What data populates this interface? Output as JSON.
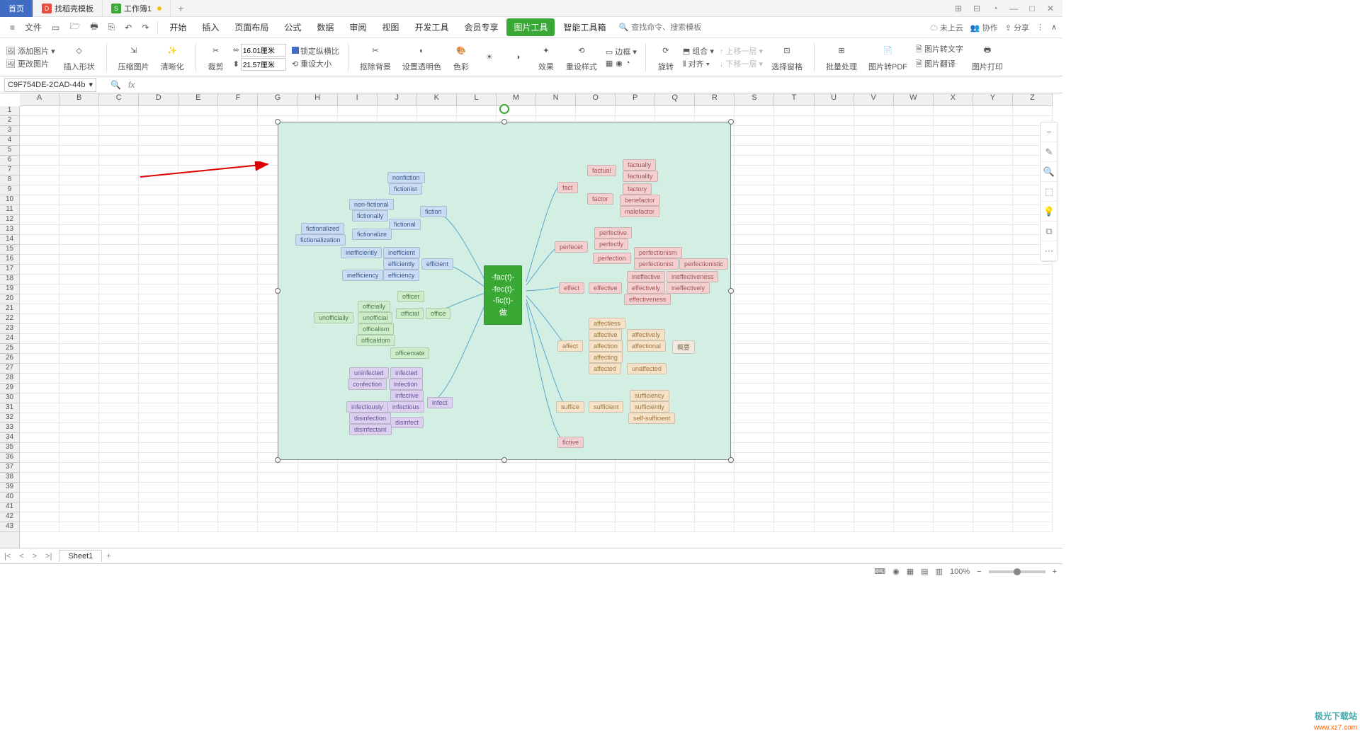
{
  "titlebar": {
    "tabs": [
      {
        "label": "首页"
      },
      {
        "label": "找稻壳模板",
        "icon": "D"
      },
      {
        "label": "工作簿1",
        "icon": "S",
        "modified": true
      }
    ]
  },
  "menubar": {
    "file": "文件",
    "items": [
      "开始",
      "插入",
      "页面布局",
      "公式",
      "数据",
      "审阅",
      "视图",
      "开发工具",
      "会员专享",
      "图片工具",
      "智能工具箱"
    ],
    "active_index": 9,
    "search_placeholder": "查找命令、搜索模板",
    "right": {
      "cloud": "未上云",
      "collab": "协作",
      "share": "分享"
    }
  },
  "ribbon": {
    "add_image": "添加图片",
    "change_image": "更改图片",
    "insert_shape": "插入形状",
    "compress": "压缩图片",
    "enhance": "清晰化",
    "crop": "裁剪",
    "width_value": "16.01厘米",
    "height_value": "21.57厘米",
    "lock_ratio": "锁定纵横比",
    "reset_size": "重设大小",
    "remove_bg": "抠除背景",
    "transparency": "设置透明色",
    "color": "色彩",
    "effect": "效果",
    "reset_style": "重设样式",
    "border": "边框",
    "rotate": "旋转",
    "combine": "组合",
    "align": "对齐",
    "layer_up": "上移一层",
    "layer_down": "下移一层",
    "select_pane": "选择窗格",
    "batch": "批量处理",
    "to_pdf": "图片转PDF",
    "to_text": "图片转文字",
    "translate": "图片翻译",
    "print": "图片打印"
  },
  "formula_bar": {
    "name": "C9F754DE-2CAD-44b",
    "fx": "fx"
  },
  "columns": [
    "A",
    "B",
    "C",
    "D",
    "E",
    "F",
    "G",
    "H",
    "I",
    "J",
    "K",
    "L",
    "M",
    "N",
    "O",
    "P",
    "Q",
    "R",
    "S",
    "T",
    "U",
    "V",
    "W",
    "X",
    "Y",
    "Z"
  ],
  "row_count": 43,
  "mindmap": {
    "center": "-fac(t)-\n-fec(t)-\n-fic(t)-\n做",
    "nodes": {
      "fiction": "fiction",
      "nonfiction": "nonfiction",
      "fictionist": "fictionist",
      "nonfictional": "non-fictional",
      "fictionally": "fictionally",
      "fictional": "fictional",
      "fictionalize": "fictionalize",
      "fictionalized": "fictionalized",
      "fictionalization": "fictionalization",
      "efficient": "efficient",
      "inefficient": "inefficient",
      "inefficiently": "inefficiently",
      "efficiently": "efficiently",
      "efficiency": "efficiency",
      "inefficiency": "inefficiency",
      "office": "office",
      "officer": "officer",
      "official": "official",
      "unofficial": "unofficial",
      "officially": "officially",
      "officialism": "officalism",
      "officialdom": "officaldom",
      "officemate": "officemate",
      "unofficially": "unofficially",
      "infect": "infect",
      "infected": "infected",
      "uninfected": "uninfected",
      "infection": "infection",
      "confection": "confection",
      "infective": "infective",
      "infectious": "infectious",
      "infectiously": "infectiously",
      "disinfect": "disinfect",
      "disinfection": "disinfection",
      "disinfectant": "disinfectant",
      "fact": "fact",
      "factual": "factual",
      "factually": "factually",
      "factuality": "factuality",
      "factor": "factor",
      "factory": "factory",
      "benefactor": "benefactor",
      "malefactor": "malefactor",
      "perfect_branch": "perfecet",
      "perfective": "perfective",
      "perfectly": "perfectly",
      "perfection": "perfection",
      "perfectionism": "perfectionism",
      "perfectionist": "perfectionist",
      "perfectionistic": "perfectionistic",
      "effect": "effect",
      "effective": "effective",
      "ineffective": "ineffective",
      "ineffectiveness": "ineffectiveness",
      "effectively": "effectively",
      "ineffectively": "ineffectively",
      "effectiveness": "effectiveness",
      "affect": "affect",
      "affectless": "affectless",
      "affective": "affective",
      "affectively": "affectively",
      "affection": "affection",
      "affectional": "affectional",
      "affecting": "affecting",
      "affected": "affected",
      "unaffected": "unaffected",
      "summary": "概要",
      "suffice": "suffice",
      "sufficient": "sufficient",
      "sufficiency": "sufficiency",
      "sufficiently": "sufficiently",
      "self_sufficient": "self-sufficient",
      "fictive": "fictive"
    }
  },
  "float_panel": [
    "−",
    "✎",
    "🔍",
    "⬚",
    "💡",
    "⧉",
    "⋯"
  ],
  "sheetbar": {
    "sheet1": "Sheet1"
  },
  "statusbar": {
    "zoom": "100%"
  },
  "watermark": {
    "brand": "极光下载站",
    "url": "www.xz7.com"
  }
}
